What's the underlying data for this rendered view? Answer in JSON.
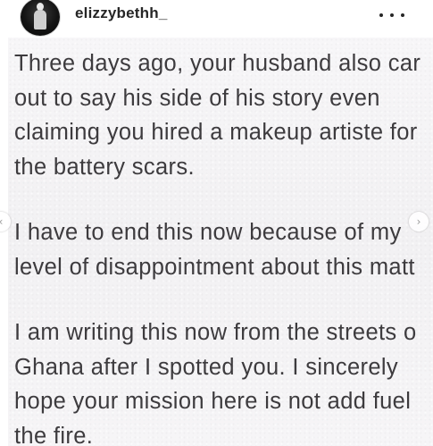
{
  "header": {
    "username": "elizzybethh_",
    "avatar_icon": "profile-photo-avatar",
    "more_icon": "more-options-icon"
  },
  "post": {
    "paragraphs": [
      {
        "lines": [
          "Three days ago, your husband also car",
          "out to say his side of his story even",
          "claiming you hired a makeup artiste for",
          "the battery scars."
        ]
      },
      {
        "lines": [
          "I have to end this now because of my",
          "level of disappointment about this matt"
        ]
      },
      {
        "lines": [
          "I am writing this now from the streets o",
          "Ghana after I spotted you. I sincerely",
          "hope your mission here is not add fuel",
          "the fire."
        ]
      }
    ],
    "text_color": "#3d3b3e",
    "background_color": "#f5f4f6"
  },
  "carousel": {
    "prev_glyph": "‹",
    "next_glyph": "›",
    "prev_icon": "chevron-left-icon",
    "next_icon": "chevron-right-icon"
  }
}
